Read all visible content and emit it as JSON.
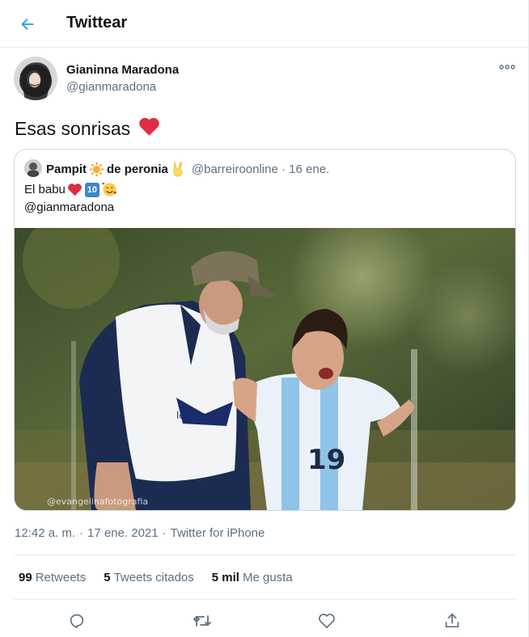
{
  "header": {
    "title": "Twittear"
  },
  "author": {
    "name": "Gianinna Maradona",
    "handle": "@gianmaradona"
  },
  "tweet": {
    "text": "Esas sonrisas"
  },
  "quote": {
    "name_part1": "Pampit",
    "name_part2": "de peronia",
    "handle_date": "@barreiroonline · 16 ene.",
    "text_line1": "El babu",
    "text_line2": "@gianmaradona",
    "badge": "10",
    "watermark": "@evangelinafotografia"
  },
  "meta": {
    "time": "12:42 a. m.",
    "date": "17 ene. 2021",
    "source": "Twitter for iPhone"
  },
  "stats": {
    "retweets_count": "99",
    "retweets_label": "Retweets",
    "quotes_count": "5",
    "quotes_label": "Tweets citados",
    "likes_count": "5 mil",
    "likes_label": "Me gusta"
  },
  "colors": {
    "accent": "#1d9bf0",
    "heart": "#dd2e44",
    "muted": "#5b7083"
  },
  "icons": [
    "back-arrow-icon",
    "more-icon",
    "reply-icon",
    "retweet-icon",
    "like-icon",
    "share-icon"
  ]
}
